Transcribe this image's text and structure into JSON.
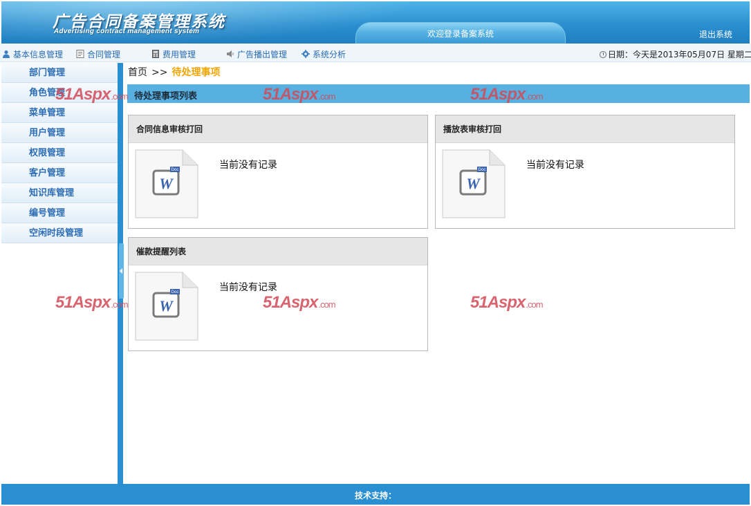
{
  "header": {
    "title": "广告合同备案管理系统",
    "subtitle": "Advertising contract management system",
    "welcome": "欢迎登录备案系统",
    "logout": "退出系统"
  },
  "topnav": {
    "items": [
      {
        "label": "基本信息管理",
        "icon": "user-icon"
      },
      {
        "label": "合同管理",
        "icon": "document-icon"
      },
      {
        "label": "费用管理",
        "icon": "calculator-icon"
      },
      {
        "label": "广告播出管理",
        "icon": "speaker-icon"
      },
      {
        "label": "系统分析",
        "icon": "gear-icon"
      }
    ],
    "date_text": "日期：今天是2013年05月07日  星期二"
  },
  "sidebar": {
    "items": [
      {
        "label": "部门管理"
      },
      {
        "label": "角色管理"
      },
      {
        "label": "菜单管理"
      },
      {
        "label": "用户管理"
      },
      {
        "label": "权限管理"
      },
      {
        "label": "客户管理"
      },
      {
        "label": "知识库管理"
      },
      {
        "label": "编号管理"
      },
      {
        "label": "空闲时段管理"
      }
    ]
  },
  "breadcrumb": {
    "home": "首页",
    "separator": ">>",
    "current": "待处理事项"
  },
  "main": {
    "list_title": "待处理事项列表",
    "panels": [
      {
        "title": "合同信息审核打回",
        "empty_text": "当前没有记录",
        "icon": "word-doc-icon"
      },
      {
        "title": "播放表审核打回",
        "empty_text": "当前没有记录",
        "icon": "word-doc-icon"
      },
      {
        "title": "催款提醒列表",
        "empty_text": "当前没有记录",
        "icon": "word-doc-icon"
      }
    ]
  },
  "watermark": {
    "main": "51Aspx",
    "suffix": ".com"
  },
  "footer": {
    "text": "技术支持："
  },
  "colors": {
    "header_blue": "#2b8fcf",
    "sidebar_text": "#2b6cb5",
    "breadcrumb_current": "#f0a500",
    "watermark": "#d24a58"
  }
}
